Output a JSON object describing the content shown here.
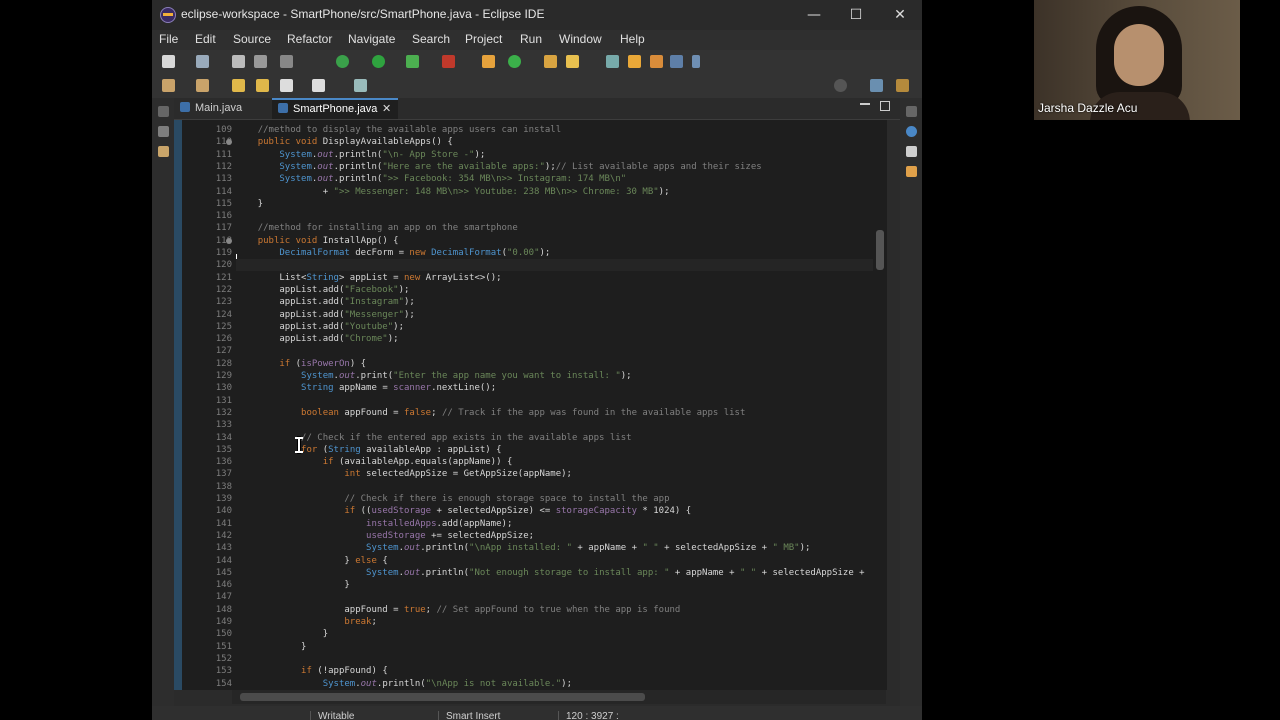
{
  "window": {
    "title": "eclipse-workspace - SmartPhone/src/SmartPhone.java - Eclipse IDE",
    "controls": [
      "—",
      "☐",
      "✕"
    ]
  },
  "menu": [
    "File",
    "Edit",
    "Source",
    "Refactor",
    "Navigate",
    "Search",
    "Project",
    "Run",
    "Window",
    "Help"
  ],
  "tabs": [
    {
      "label": "Main.java",
      "active": false
    },
    {
      "label": "SmartPhone.java",
      "active": true,
      "close": "✕"
    }
  ],
  "editor": {
    "current_line": "120",
    "lines": [
      {
        "n": "109",
        "t": "    //method to display the available apps users can install"
      },
      {
        "n": "110",
        "t": "    public void DisplayAvailableApps() {"
      },
      {
        "n": "111",
        "t": "        System.out.println(\"\\n- App Store -\");"
      },
      {
        "n": "112",
        "t": "        System.out.println(\"Here are the available apps:\");// List available apps and their sizes"
      },
      {
        "n": "113",
        "t": "        System.out.println(\">> Facebook: 354 MB\\n>> Instagram: 174 MB\\n\""
      },
      {
        "n": "114",
        "t": "                + \">> Messenger: 148 MB\\n>> Youtube: 238 MB\\n>> Chrome: 30 MB\");"
      },
      {
        "n": "115",
        "t": "    }"
      },
      {
        "n": "116",
        "t": ""
      },
      {
        "n": "117",
        "t": "    //method for installing an app on the smartphone"
      },
      {
        "n": "118",
        "t": "    public void InstallApp() {"
      },
      {
        "n": "119",
        "t": "        DecimalFormat decForm = new DecimalFormat(\"0.00\");"
      },
      {
        "n": "120",
        "t": ""
      },
      {
        "n": "121",
        "t": "        List<String> appList = new ArrayList<>();"
      },
      {
        "n": "122",
        "t": "        appList.add(\"Facebook\");"
      },
      {
        "n": "123",
        "t": "        appList.add(\"Instagram\");"
      },
      {
        "n": "124",
        "t": "        appList.add(\"Messenger\");"
      },
      {
        "n": "125",
        "t": "        appList.add(\"Youtube\");"
      },
      {
        "n": "126",
        "t": "        appList.add(\"Chrome\");"
      },
      {
        "n": "127",
        "t": ""
      },
      {
        "n": "128",
        "t": "        if (isPowerOn) {"
      },
      {
        "n": "129",
        "t": "            System.out.print(\"Enter the app name you want to install: \");"
      },
      {
        "n": "130",
        "t": "            String appName = scanner.nextLine();"
      },
      {
        "n": "131",
        "t": ""
      },
      {
        "n": "132",
        "t": "            boolean appFound = false; // Track if the app was found in the available apps list"
      },
      {
        "n": "133",
        "t": ""
      },
      {
        "n": "134",
        "t": "            // Check if the entered app exists in the available apps list"
      },
      {
        "n": "135",
        "t": "            for (String availableApp : appList) {"
      },
      {
        "n": "136",
        "t": "                if (availableApp.equals(appName)) {"
      },
      {
        "n": "137",
        "t": "                    int selectedAppSize = GetAppSize(appName);"
      },
      {
        "n": "138",
        "t": ""
      },
      {
        "n": "139",
        "t": "                    // Check if there is enough storage space to install the app"
      },
      {
        "n": "140",
        "t": "                    if ((usedStorage + selectedAppSize) <= storageCapacity * 1024) {"
      },
      {
        "n": "141",
        "t": "                        installedApps.add(appName);"
      },
      {
        "n": "142",
        "t": "                        usedStorage += selectedAppSize;"
      },
      {
        "n": "143",
        "t": "                        System.out.println(\"\\nApp installed: \" + appName + \" \" + selectedAppSize + \" MB\");"
      },
      {
        "n": "144",
        "t": "                    } else {"
      },
      {
        "n": "145",
        "t": "                        System.out.println(\"Not enough storage to install app: \" + appName + \" \" + selectedAppSize +"
      },
      {
        "n": "146",
        "t": "                    }"
      },
      {
        "n": "147",
        "t": ""
      },
      {
        "n": "148",
        "t": "                    appFound = true; // Set appFound to true when the app is found"
      },
      {
        "n": "149",
        "t": "                    break;"
      },
      {
        "n": "150",
        "t": "                }"
      },
      {
        "n": "151",
        "t": "            }"
      },
      {
        "n": "152",
        "t": ""
      },
      {
        "n": "153",
        "t": "            if (!appFound) {"
      },
      {
        "n": "154",
        "t": "                System.out.println(\"\\nApp is not available.\");"
      }
    ]
  },
  "status": {
    "mode": "Writable",
    "insert": "Smart Insert",
    "position": "120 : 3927 :"
  },
  "participant": {
    "name": "Jarsha Dazzle Acu"
  },
  "colors": {
    "keyword": "#cc7832",
    "string": "#6a8759",
    "comment": "#808080",
    "field": "#9876aa",
    "type": "#4e94ce",
    "method": "#e0c46c"
  }
}
